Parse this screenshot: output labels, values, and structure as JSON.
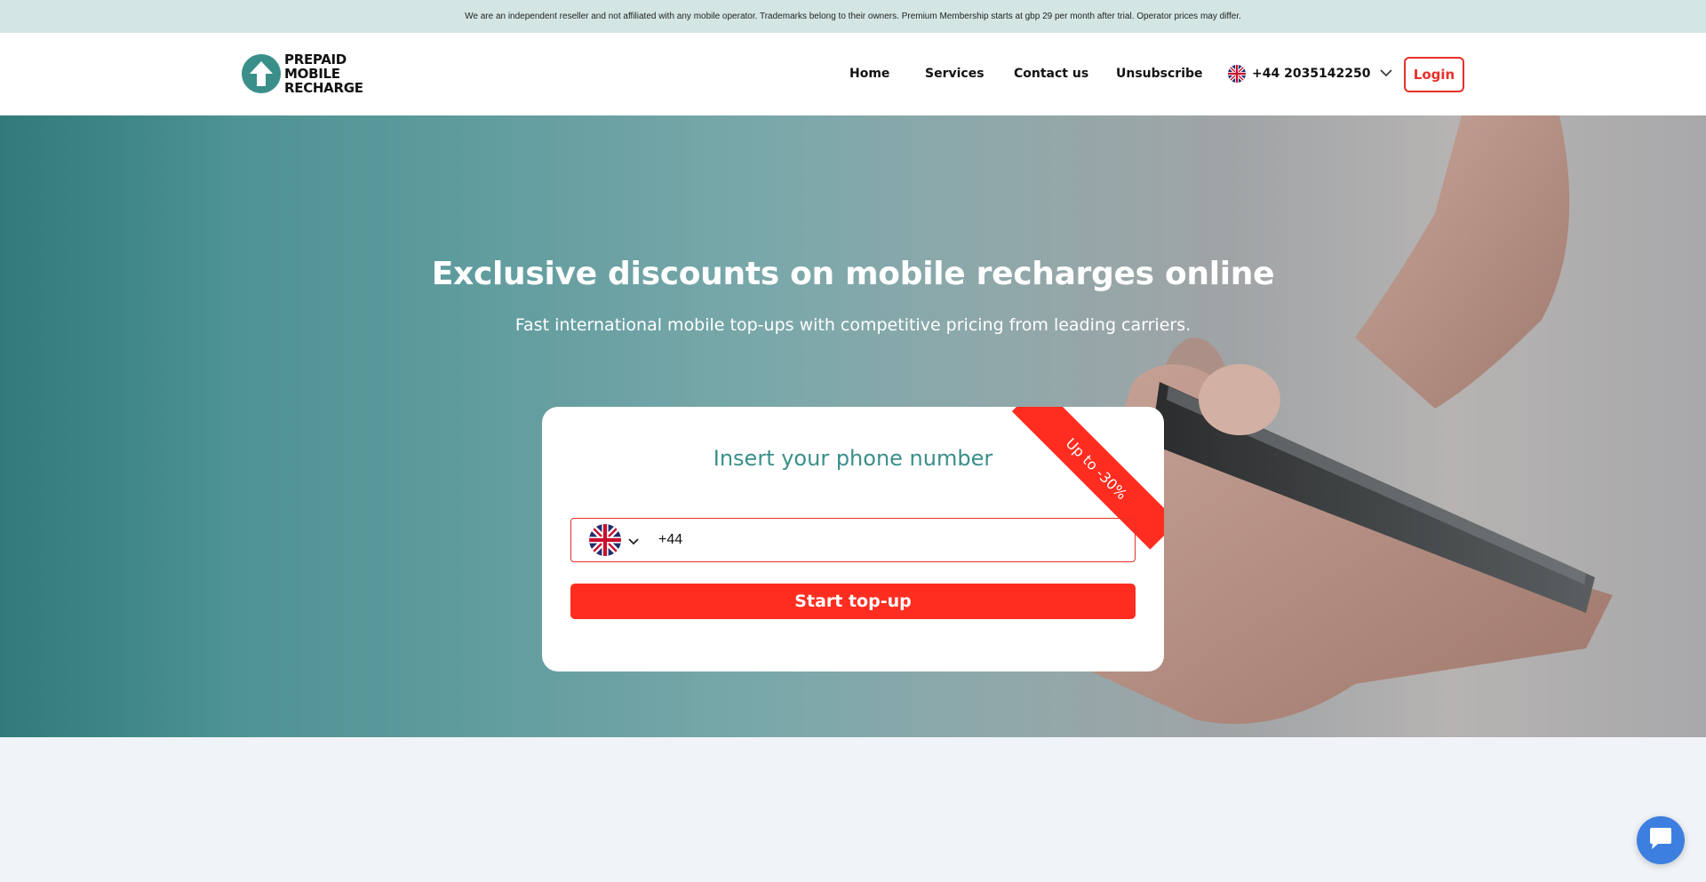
{
  "disclaimer": "We are an independent reseller and not affiliated with any mobile operator. Trademarks belong to their owners. Premium Membership starts at gbp 29 per month after trial. Operator prices may differ.",
  "logo": {
    "line1": "PREPAID",
    "line2": "MOBILE",
    "line3": "RECHARGE",
    "icon": "upload-arrow-icon"
  },
  "nav": {
    "home": "Home",
    "services": "Services",
    "contact": "Contact us",
    "unsubscribe": "Unsubscribe"
  },
  "phone_select": {
    "number": "+44 2035142250",
    "flag": "uk-flag-icon"
  },
  "login_label": "Login",
  "hero": {
    "title": "Exclusive discounts on mobile recharges online",
    "subtitle": "Fast international mobile top-ups with competitive pricing from leading carriers."
  },
  "card": {
    "title": "Insert your phone number",
    "ribbon": "Up to -30%",
    "phone_value": "+44",
    "start_label": "Start top-up"
  },
  "colors": {
    "accent": "#3a8f8a",
    "cta": "#ff2d20",
    "topbar": "#d3e6e4",
    "chat": "#3d7fe0"
  }
}
